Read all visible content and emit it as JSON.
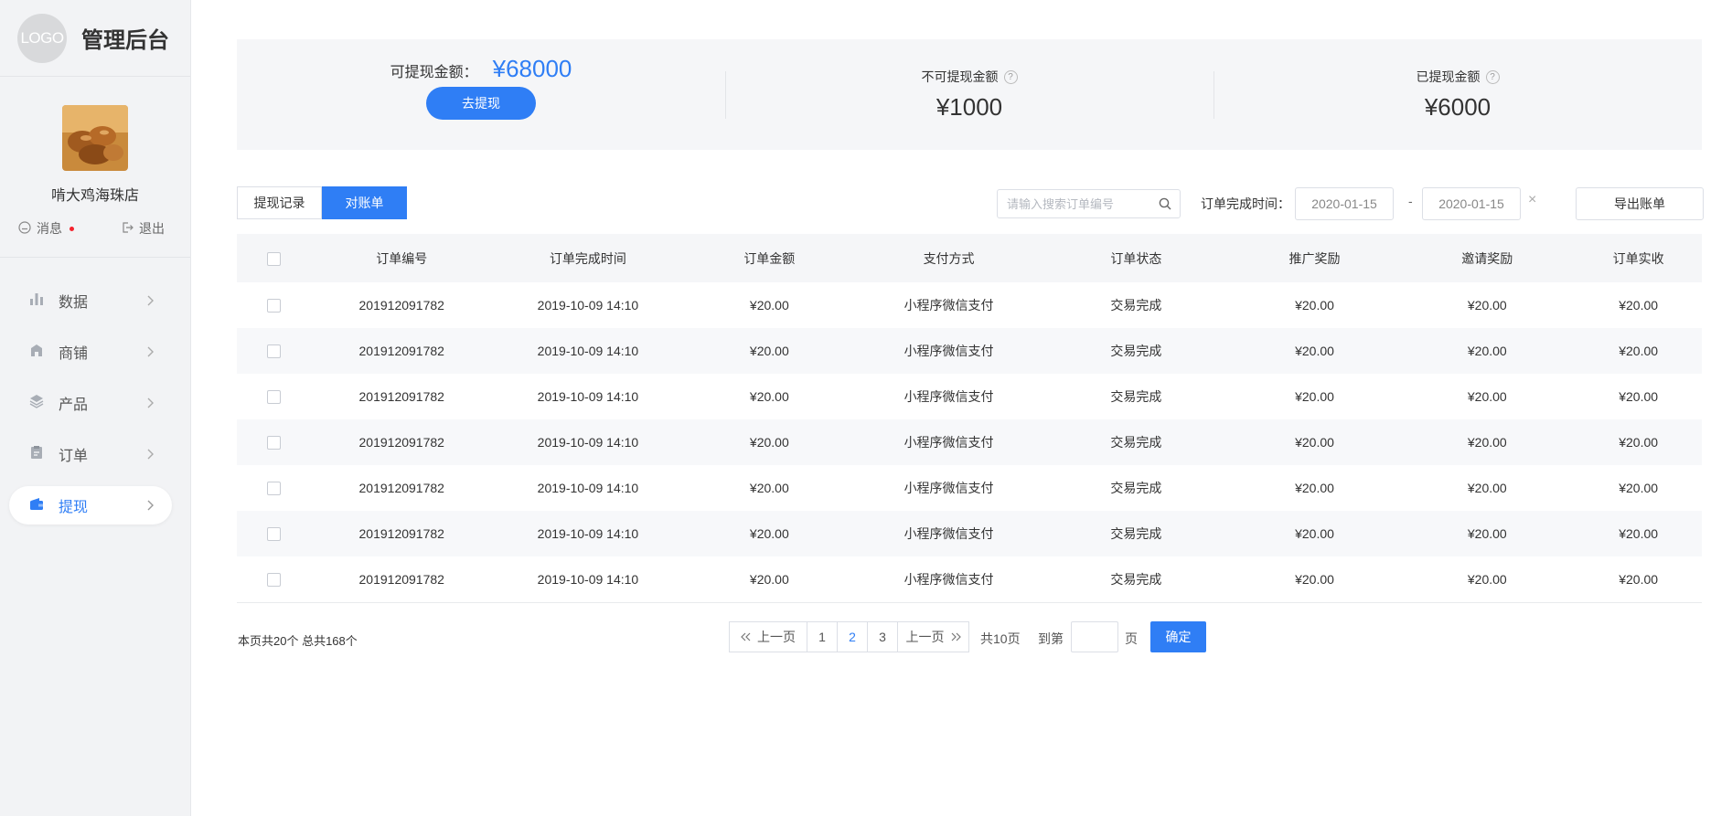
{
  "brand": {
    "logo_text": "LOGO",
    "title": "管理后台"
  },
  "profile": {
    "shop_name": "啃大鸡海珠店",
    "messages_label": "消息",
    "logout_label": "退出"
  },
  "nav": {
    "items": [
      {
        "label": "数据",
        "icon": "bar-chart-icon",
        "active": false
      },
      {
        "label": "商铺",
        "icon": "shop-icon",
        "active": false
      },
      {
        "label": "产品",
        "icon": "layers-icon",
        "active": false
      },
      {
        "label": "订单",
        "icon": "clipboard-icon",
        "active": false
      },
      {
        "label": "提现",
        "icon": "wallet-icon",
        "active": true
      }
    ]
  },
  "summary": {
    "available_label": "可提现金额：",
    "available_value": "¥68000",
    "withdraw_button": "去提现",
    "locked_label": "不可提现金额",
    "locked_value": "¥1000",
    "withdrawn_label": "已提现金额",
    "withdrawn_value": "¥6000",
    "help_mark": "?"
  },
  "tabs": {
    "records": "提现记录",
    "statement": "对账单",
    "active": "statement"
  },
  "filters": {
    "search_placeholder": "请输入搜索订单编号",
    "date_label": "订单完成时间：",
    "date_start": "2020-01-15",
    "date_separator": "-",
    "date_end": "2020-01-15",
    "clear": "×",
    "export_button": "导出账单"
  },
  "table": {
    "columns": [
      "订单编号",
      "订单完成时间",
      "订单金额",
      "支付方式",
      "订单状态",
      "推广奖励",
      "邀请奖励",
      "订单实收"
    ],
    "rows": [
      [
        "201912091782",
        "2019-10-09 14:10",
        "¥20.00",
        "小程序微信支付",
        "交易完成",
        "¥20.00",
        "¥20.00",
        "¥20.00"
      ],
      [
        "201912091782",
        "2019-10-09 14:10",
        "¥20.00",
        "小程序微信支付",
        "交易完成",
        "¥20.00",
        "¥20.00",
        "¥20.00"
      ],
      [
        "201912091782",
        "2019-10-09 14:10",
        "¥20.00",
        "小程序微信支付",
        "交易完成",
        "¥20.00",
        "¥20.00",
        "¥20.00"
      ],
      [
        "201912091782",
        "2019-10-09 14:10",
        "¥20.00",
        "小程序微信支付",
        "交易完成",
        "¥20.00",
        "¥20.00",
        "¥20.00"
      ],
      [
        "201912091782",
        "2019-10-09 14:10",
        "¥20.00",
        "小程序微信支付",
        "交易完成",
        "¥20.00",
        "¥20.00",
        "¥20.00"
      ],
      [
        "201912091782",
        "2019-10-09 14:10",
        "¥20.00",
        "小程序微信支付",
        "交易完成",
        "¥20.00",
        "¥20.00",
        "¥20.00"
      ],
      [
        "201912091782",
        "2019-10-09 14:10",
        "¥20.00",
        "小程序微信支付",
        "交易完成",
        "¥20.00",
        "¥20.00",
        "¥20.00"
      ]
    ]
  },
  "pagination": {
    "summary": "本页共20个  总共168个",
    "prev_label": "上一页",
    "next_label": "上一页",
    "pages": [
      "1",
      "2",
      "3"
    ],
    "current_page": "2",
    "total_pages": "共10页",
    "goto_label": "到第",
    "goto_value": "",
    "page_unit": "页",
    "confirm_button": "确定"
  },
  "colors": {
    "accent": "#2f7ef5",
    "sidebar_bg": "#f2f3f5",
    "panel_bg": "#f5f6f8",
    "alert_dot": "#f5222d"
  }
}
